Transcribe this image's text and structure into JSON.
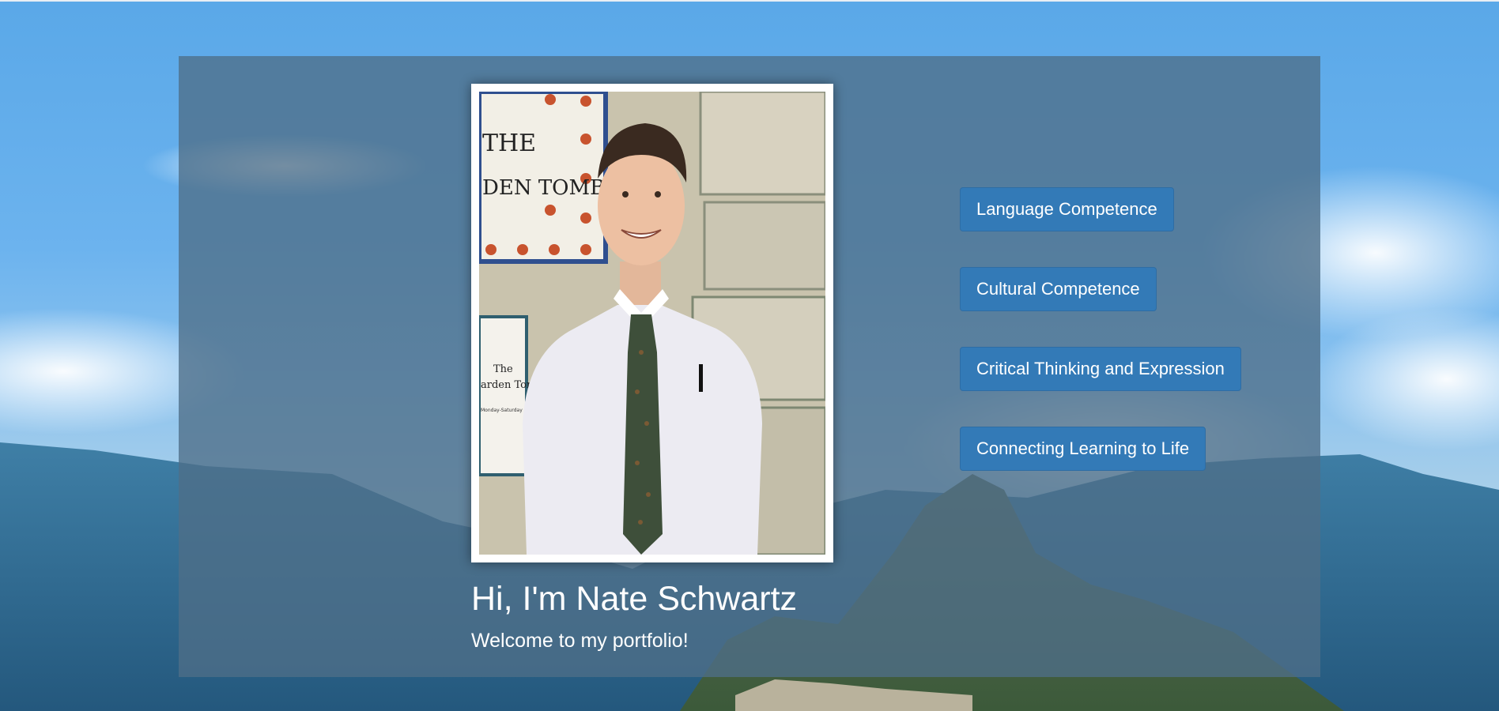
{
  "hero": {
    "title": "Hi, I'm Nate Schwartz",
    "subtitle": "Welcome to my portfolio!"
  },
  "photo": {
    "sign_top_line1": "THE",
    "sign_top_line2": "DEN TOMB",
    "sign_plaque_line1": "The",
    "sign_plaque_line2": "arden Tom",
    "sign_small_text": "Monday-Saturday"
  },
  "nav": {
    "items": [
      {
        "label": "Language Competence"
      },
      {
        "label": "Cultural Competence"
      },
      {
        "label": "Critical Thinking and Expression"
      },
      {
        "label": "Connecting Learning to Life"
      }
    ]
  },
  "colors": {
    "button": "#337ab7",
    "panel": "rgba(78,110,136,0.78)",
    "sky": "#5aa8e8"
  }
}
